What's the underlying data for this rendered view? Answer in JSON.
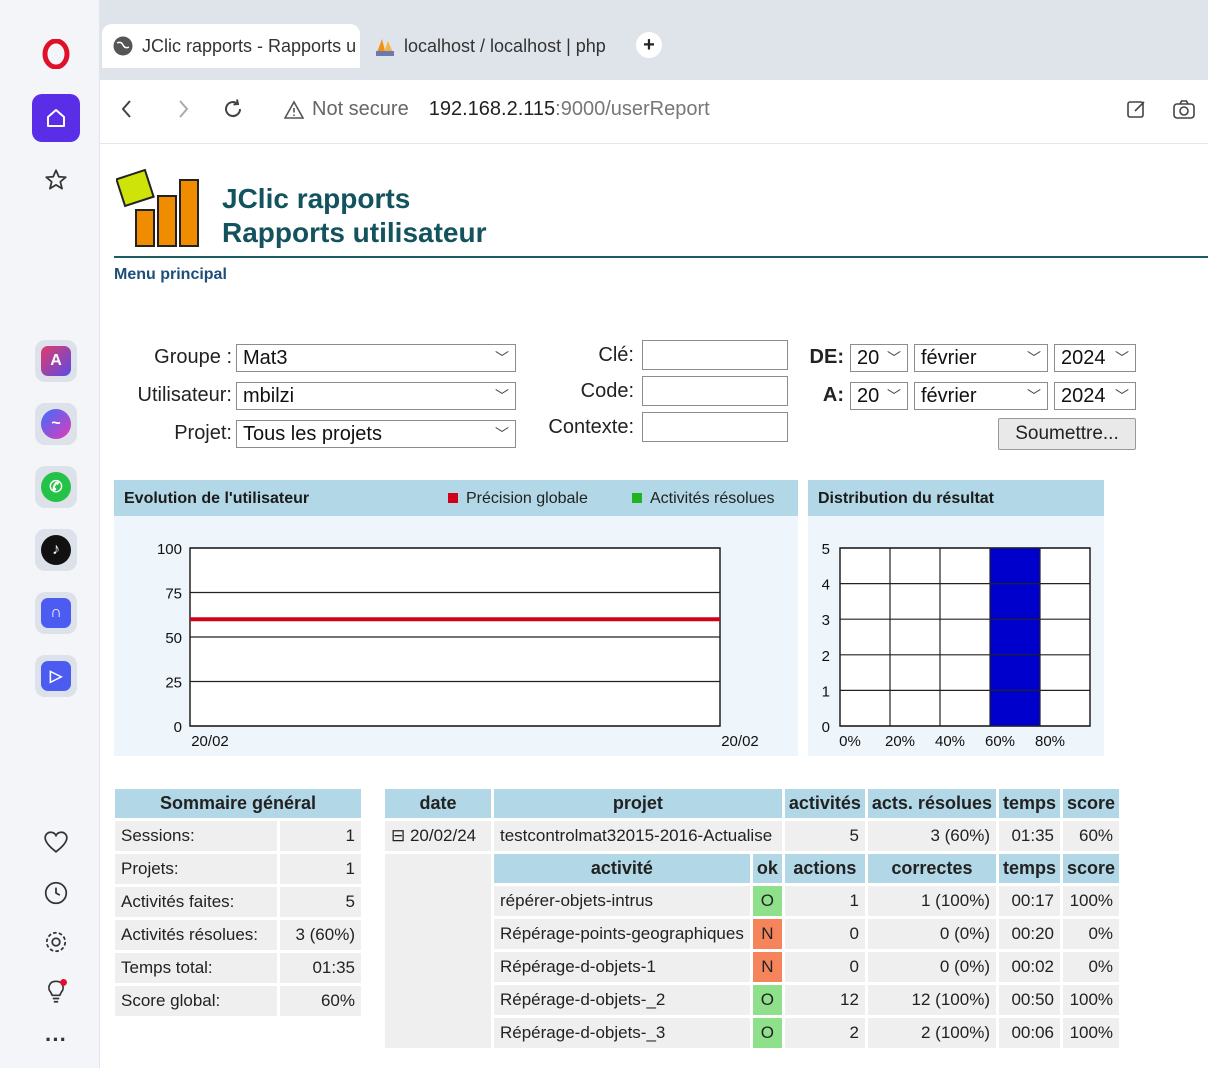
{
  "browser": {
    "tabs": [
      {
        "label": "JClic rapports - Rapports u"
      },
      {
        "label": "localhost / localhost | php"
      }
    ],
    "new_tab": "+",
    "not_secure": "Not secure",
    "url_host": "192.168.2.115",
    "url_rest": ":9000/userReport"
  },
  "page": {
    "title_line1": "JClic rapports",
    "title_line2": "Rapports utilisateur",
    "menu_link": "Menu principal"
  },
  "filters": {
    "groupe_label": "Groupe :",
    "groupe_value": "Mat3",
    "utilisateur_label": "Utilisateur:",
    "utilisateur_value": "mbilzi",
    "projet_label": "Projet:",
    "projet_value": "Tous les projets",
    "cle_label": "Clé:",
    "code_label": "Code:",
    "contexte_label": "Contexte:",
    "de_label": "DE:",
    "a_label": "A:",
    "de_day": "20",
    "de_month": "février",
    "de_year": "2024",
    "a_day": "20",
    "a_month": "février",
    "a_year": "2024",
    "submit": "Soumettre..."
  },
  "chart_evolution": {
    "title": "Evolution de l'utilisateur",
    "legend_precision": "Précision globale",
    "legend_activites": "Activités résolues",
    "precision_color": "#d0021b",
    "activites_color": "#22b322"
  },
  "chart_distribution": {
    "title": "Distribution du résultat",
    "bar_color": "#0000cc"
  },
  "chart_data": [
    {
      "type": "line",
      "title": "Evolution de l'utilisateur",
      "x": [
        "20/02",
        "20/02"
      ],
      "yticks": [
        "100",
        "75",
        "50",
        "25",
        "0"
      ],
      "ylim": [
        0,
        100
      ],
      "series": [
        {
          "name": "Précision globale",
          "values": [
            60,
            60
          ]
        }
      ],
      "grid": true,
      "legend": "top"
    },
    {
      "type": "bar",
      "title": "Distribution du résultat",
      "categories": [
        "0%",
        "20%",
        "40%",
        "60%",
        "80%"
      ],
      "values": [
        0,
        0,
        0,
        5,
        0
      ],
      "yticks": [
        "5",
        "4",
        "3",
        "2",
        "1",
        "0"
      ],
      "ylim": [
        0,
        5
      ],
      "grid": true
    }
  ],
  "summary": {
    "header": "Sommaire général",
    "rows": [
      {
        "label": "Sessions:",
        "value": "1"
      },
      {
        "label": "Projets:",
        "value": "1"
      },
      {
        "label": "Activités faites:",
        "value": "5"
      },
      {
        "label": "Activités résolues:",
        "value": "3 (60%)"
      },
      {
        "label": "Temps total:",
        "value": "01:35"
      },
      {
        "label": "Score global:",
        "value": "60%"
      }
    ]
  },
  "detail": {
    "headers": {
      "date": "date",
      "projet": "projet",
      "activites": "activités",
      "acts_resolues": "acts. résolues",
      "temps": "temps",
      "score": "score"
    },
    "session": {
      "date": "⊟ 20/02/24",
      "projet": "testcontrolmat32015-2016-Actualise",
      "activites": "5",
      "acts_resolues": "3 (60%)",
      "temps": "01:35",
      "score": "60%"
    },
    "sub_headers": {
      "activite": "activité",
      "ok": "ok",
      "actions": "actions",
      "correctes": "correctes",
      "temps": "temps",
      "score": "score"
    },
    "rows": [
      {
        "activite": "répérer-objets-intrus",
        "ok": "O",
        "actions": "1",
        "correctes": "1 (100%)",
        "temps": "00:17",
        "score": "100%"
      },
      {
        "activite": "Répérage-points-geographiques",
        "ok": "N",
        "actions": "0",
        "correctes": "0 (0%)",
        "temps": "00:20",
        "score": "0%"
      },
      {
        "activite": "Répérage-d-objets-1",
        "ok": "N",
        "actions": "0",
        "correctes": "0 (0%)",
        "temps": "00:02",
        "score": "0%"
      },
      {
        "activite": "Répérage-d-objets-_2",
        "ok": "O",
        "actions": "12",
        "correctes": "12 (100%)",
        "temps": "00:50",
        "score": "100%"
      },
      {
        "activite": "Répérage-d-objets-_3",
        "ok": "O",
        "actions": "2",
        "correctes": "2 (100%)",
        "temps": "00:06",
        "score": "100%"
      }
    ]
  },
  "sidebar": {
    "icons": [
      "opera-logo-icon",
      "home-icon",
      "bookmarks-star-icon",
      "aria-icon",
      "messenger-icon",
      "whatsapp-icon",
      "tiktok-icon",
      "music-player-icon",
      "player-icon",
      "heart-icon",
      "history-clock-icon",
      "settings-gear-icon",
      "tips-bulb-icon",
      "more-dots-icon"
    ]
  }
}
